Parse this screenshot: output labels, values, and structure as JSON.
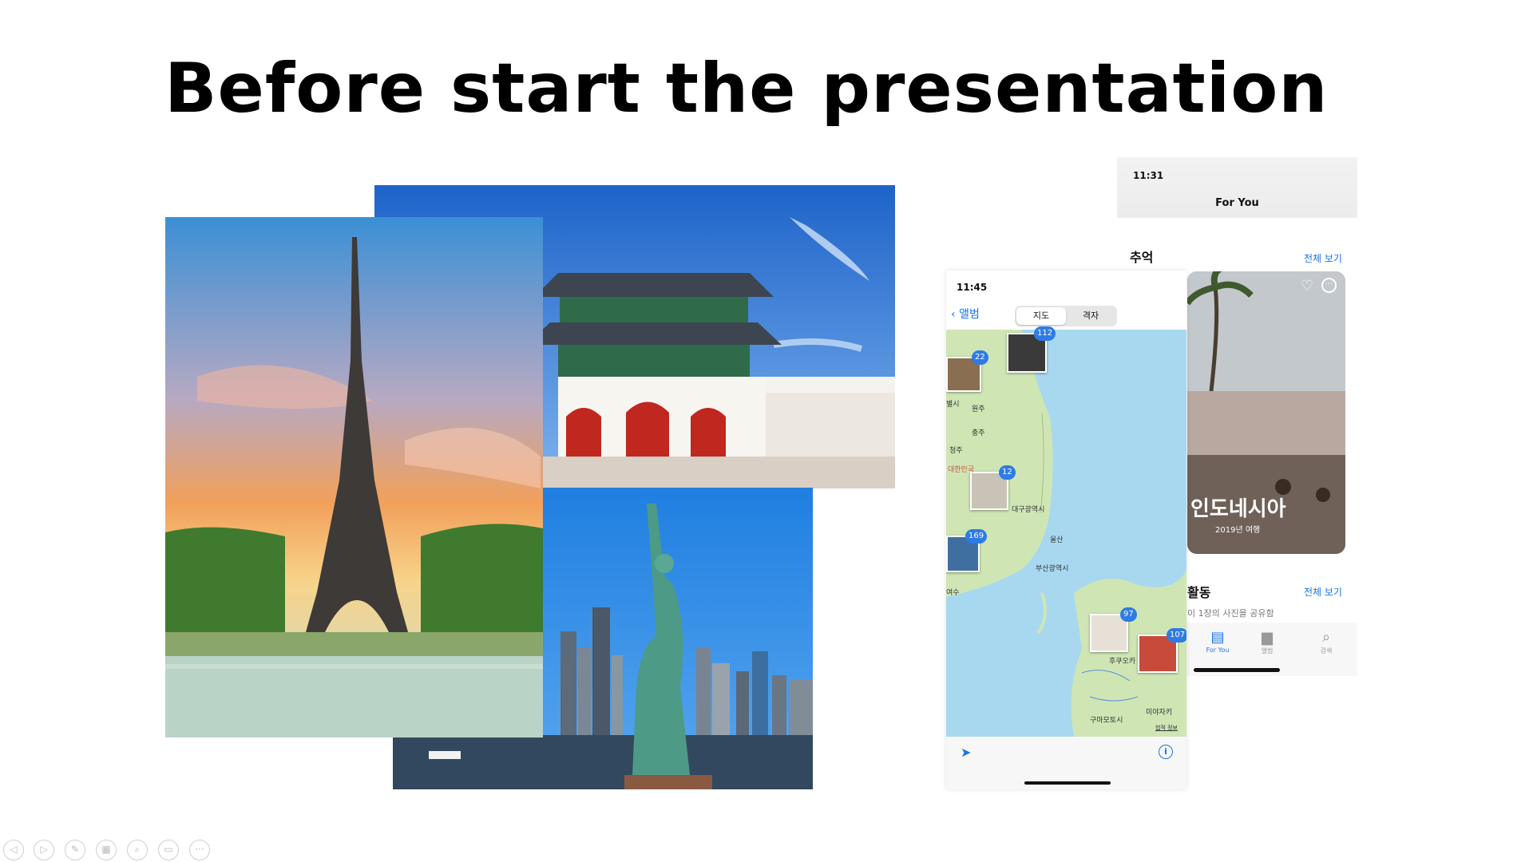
{
  "slide": {
    "title": "Before start the presentation"
  },
  "photos": {
    "eiffel": "eiffel-tower-photo",
    "gate": "gyeongbokgung-gate-photo",
    "liberty": "statue-of-liberty-photo"
  },
  "phone_foryou": {
    "time": "11:31",
    "title": "For You",
    "memories_label": "추억",
    "memories_link": "전체 보기",
    "card_title": "인도네시아",
    "card_subtitle": "2019년 여행",
    "activity_label": "활동",
    "activity_link": "전체 보기",
    "activity_sub": "이 1장의 사진을 공유함",
    "tabs": [
      {
        "label": "For You",
        "icon": "for-you-icon"
      },
      {
        "label": "앨범",
        "icon": "album-icon"
      },
      {
        "label": "검색",
        "icon": "search-icon"
      }
    ]
  },
  "phone_map": {
    "time": "11:45",
    "back_label": "앨범",
    "segments": [
      "지도",
      "격자"
    ],
    "clusters": [
      "22",
      "112",
      "12",
      "169",
      "97",
      "107"
    ],
    "cities": [
      "원주",
      "충주",
      "청주",
      "대한민국",
      "대구광역시",
      "울산",
      "부산광역시",
      "후쿠오카",
      "구마모토시",
      "미야자키"
    ],
    "partial_labels": [
      "별시",
      "여수"
    ],
    "map_credit": "법적 정보"
  },
  "toolbar": {
    "buttons": [
      "prev-icon",
      "next-icon",
      "pen-icon",
      "slides-icon",
      "zoom-icon",
      "subtitles-icon",
      "more-icon"
    ]
  },
  "colors": {
    "accent": "#2f7be5",
    "sea": "#a8d8f0",
    "land": "#cfe6b4"
  }
}
